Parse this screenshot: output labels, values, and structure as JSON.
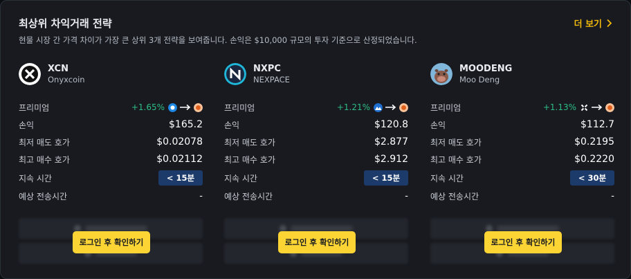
{
  "header": {
    "title": "최상위 차익거래 전략",
    "subtitle": "현물 시장 간 가격 차이가 가장 큰 상위 3개 전략을 보여줍니다. 손익은 $10,000 규모의 투자 기준으로 산정되었습니다.",
    "more_label": "더 보기"
  },
  "labels": {
    "premium": "프리미엄",
    "pnl": "손익",
    "lowest_ask": "최저 매도 호가",
    "highest_bid": "최고 매수 호가",
    "duration": "지속 시간",
    "est_transfer": "예상 전송시간"
  },
  "login_label": "로그인 후 확인하기",
  "colors": {
    "accent": "#f0b90b",
    "button": "#fcd535",
    "positive": "#2ebd85",
    "badge": "#1c3b6b"
  },
  "cards": [
    {
      "symbol": "XCN",
      "name": "Onyxcoin",
      "logo_icon": "xcn-logo-icon",
      "premium": "+1.65%",
      "from_exchange_icon": "blue-exchange-icon",
      "to_exchange_icon": "orange-exchange-icon",
      "pnl": "$165.2",
      "lowest_ask": "$0.02078",
      "highest_bid": "$0.02112",
      "duration": "< 15분",
      "est_transfer": "-"
    },
    {
      "symbol": "NXPC",
      "name": "NEXPACE",
      "logo_icon": "nxpc-logo-icon",
      "premium": "+1.21%",
      "from_exchange_icon": "mountain-exchange-icon",
      "to_exchange_icon": "orange-exchange-icon",
      "pnl": "$120.8",
      "lowest_ask": "$2.877",
      "highest_bid": "$2.912",
      "duration": "< 15분",
      "est_transfer": "-"
    },
    {
      "symbol": "MOODENG",
      "name": "Moo Deng",
      "logo_icon": "moodeng-logo-icon",
      "premium": "+1.13%",
      "from_exchange_icon": "cross-exchange-icon",
      "to_exchange_icon": "orange-exchange-icon",
      "pnl": "$112.7",
      "lowest_ask": "$0.2195",
      "highest_bid": "$0.2220",
      "duration": "< 30분",
      "est_transfer": "-"
    }
  ]
}
